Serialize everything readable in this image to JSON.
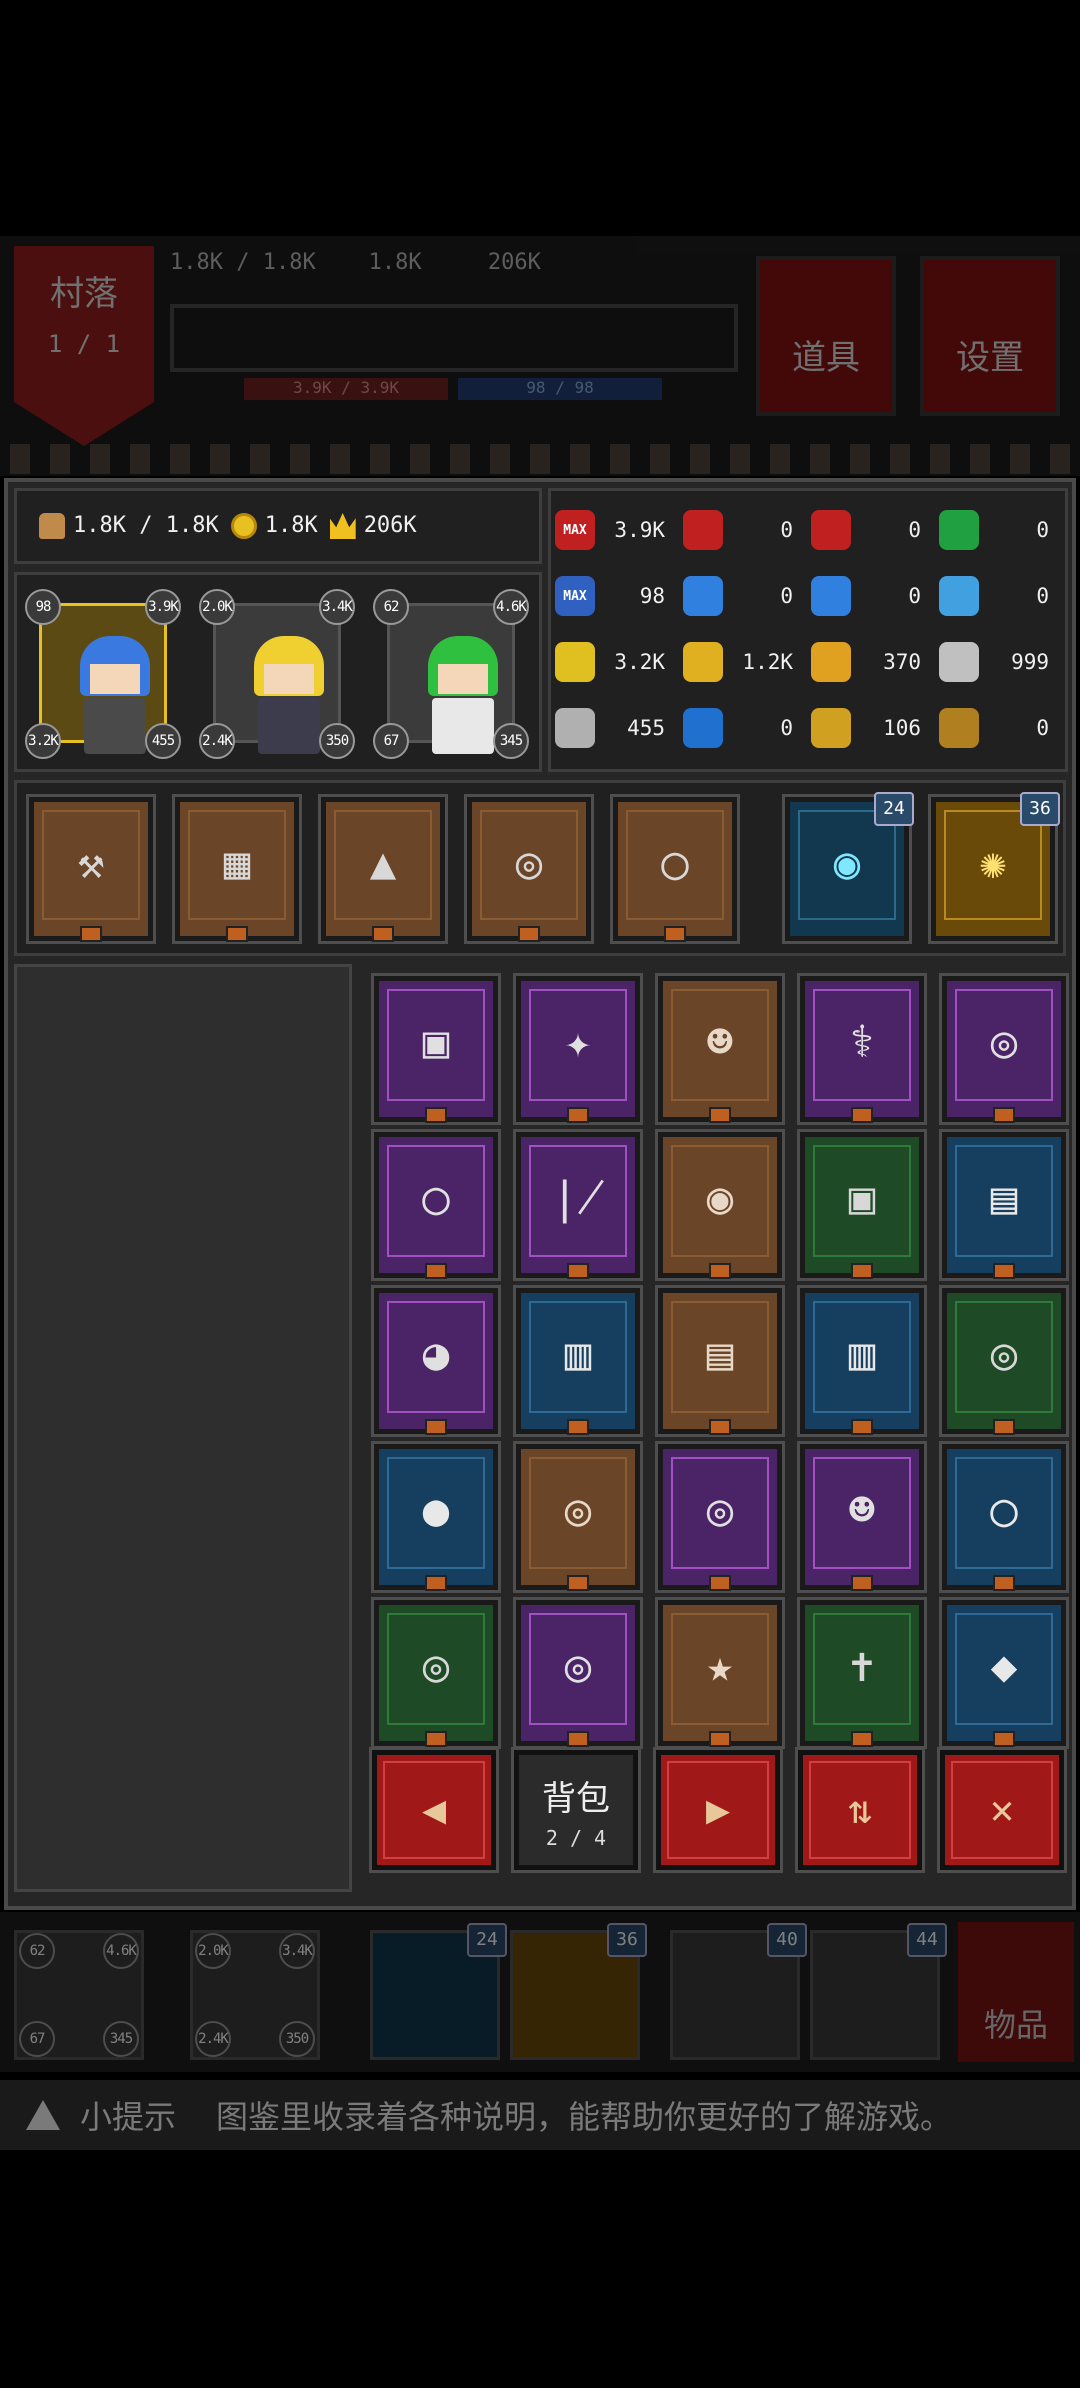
{
  "background_hud": {
    "village_label": "村落",
    "village_page": "1 / 1",
    "resources": "1.8K / 1.8K    1.8K     206K",
    "hp_bar": "3.9K / 3.9K",
    "mp_bar": "98 / 98",
    "items_button": "道具",
    "settings_button": "设置"
  },
  "resources": {
    "food": "1.8K / 1.8K",
    "gold": "1.8K",
    "crown": "206K"
  },
  "heroes": [
    {
      "top_left": "98",
      "top_right": "3.9K",
      "bottom_left": "3.2K",
      "bottom_right": "455",
      "hair": "#3a7ae0",
      "body": "#4a4a4a",
      "selected": true
    },
    {
      "top_left": "2.0K",
      "top_right": "3.4K",
      "bottom_left": "2.4K",
      "bottom_right": "350",
      "hair": "#f0d030",
      "body": "#3c3c4c",
      "selected": false
    },
    {
      "top_left": "62",
      "top_right": "4.6K",
      "bottom_left": "67",
      "bottom_right": "345",
      "hair": "#30c040",
      "body": "#e8e8e8",
      "selected": false
    }
  ],
  "stats": [
    {
      "icon": "max-heart-icon",
      "label": "MAX",
      "value": "3.9K",
      "color": "#c02020"
    },
    {
      "icon": "heart-plus-icon",
      "value": "0",
      "color": "#c02020"
    },
    {
      "icon": "heart-s-icon",
      "value": "0",
      "color": "#c02020"
    },
    {
      "icon": "green-heart-icon",
      "value": "0",
      "color": "#20a040"
    },
    {
      "icon": "max-mana-icon",
      "label": "MAX",
      "value": "98",
      "color": "#3060c0"
    },
    {
      "icon": "mana-potion-plus-icon",
      "value": "0",
      "color": "#3080e0"
    },
    {
      "icon": "mana-potion-s-icon",
      "value": "0",
      "color": "#3080e0"
    },
    {
      "icon": "blue-star-icon",
      "value": "0",
      "color": "#40a0e0"
    },
    {
      "icon": "gold-potion-icon",
      "value": "3.2K",
      "color": "#e0c020"
    },
    {
      "icon": "gold-coin-icon",
      "value": "1.2K",
      "color": "#e0b020"
    },
    {
      "icon": "gold-star-icon",
      "value": "370",
      "color": "#e0a020"
    },
    {
      "icon": "armor-shield-icon",
      "value": "999",
      "color": "#c0c0c0"
    },
    {
      "icon": "silver-shield-icon",
      "value": "455",
      "color": "#b0b0b0"
    },
    {
      "icon": "blue-gem-icon",
      "value": "0",
      "color": "#2070d0"
    },
    {
      "icon": "gold-badge-icon",
      "value": "106",
      "color": "#d0a020"
    },
    {
      "icon": "bronze-badge-icon",
      "value": "0",
      "color": "#b08020"
    }
  ],
  "equipment": [
    {
      "icon": "hammer-icon",
      "glyph": "⚒"
    },
    {
      "icon": "armor-plate-icon",
      "glyph": "▦"
    },
    {
      "icon": "hat-icon",
      "glyph": "▲"
    },
    {
      "icon": "necklace-icon",
      "glyph": "◎"
    },
    {
      "icon": "ring-icon",
      "glyph": "◯"
    }
  ],
  "skills": [
    {
      "icon": "signal-person-skill-icon",
      "count": "24"
    },
    {
      "icon": "golden-burst-skill-icon",
      "count": "36"
    }
  ],
  "bag_items": [
    {
      "icon": "gauntlet-icon",
      "glyph": "▣",
      "rarity": "purple"
    },
    {
      "icon": "shuriken-icon",
      "glyph": "✦",
      "rarity": "purple"
    },
    {
      "icon": "skull-ring-icon",
      "glyph": "☻",
      "rarity": "brown"
    },
    {
      "icon": "staff-icon",
      "glyph": "⚕",
      "rarity": "purple"
    },
    {
      "icon": "necklace-icon",
      "glyph": "◎",
      "rarity": "purple"
    },
    {
      "icon": "gold-ring-icon",
      "glyph": "◯",
      "rarity": "purple"
    },
    {
      "icon": "bone-wand-icon",
      "glyph": "∤",
      "rarity": "purple"
    },
    {
      "icon": "round-shield-icon",
      "glyph": "◉",
      "rarity": "brown"
    },
    {
      "icon": "gauntlet-icon",
      "glyph": "▣",
      "rarity": "green"
    },
    {
      "icon": "tunic-icon",
      "glyph": "▤",
      "rarity": "blue"
    },
    {
      "icon": "eye-amulet-icon",
      "glyph": "◕",
      "rarity": "purple"
    },
    {
      "icon": "spellbook-icon",
      "glyph": "▥",
      "rarity": "blue"
    },
    {
      "icon": "tunic-icon",
      "glyph": "▤",
      "rarity": "brown"
    },
    {
      "icon": "tome-icon",
      "glyph": "▥",
      "rarity": "blue"
    },
    {
      "icon": "necklace-icon",
      "glyph": "◎",
      "rarity": "green"
    },
    {
      "icon": "striped-orb-icon",
      "glyph": "●",
      "rarity": "blue"
    },
    {
      "icon": "necklace-icon",
      "glyph": "◎",
      "rarity": "brown"
    },
    {
      "icon": "bone-necklace-icon",
      "glyph": "◎",
      "rarity": "purple"
    },
    {
      "icon": "skull-ring-icon",
      "glyph": "☻",
      "rarity": "purple"
    },
    {
      "icon": "silver-ring-icon",
      "glyph": "◯",
      "rarity": "blue"
    },
    {
      "icon": "gem-necklace-icon",
      "glyph": "◎",
      "rarity": "green"
    },
    {
      "icon": "necklace-icon",
      "glyph": "◎",
      "rarity": "purple"
    },
    {
      "icon": "star-wand-icon",
      "glyph": "★",
      "rarity": "brown"
    },
    {
      "icon": "cross-ring-icon",
      "glyph": "✝",
      "rarity": "green"
    },
    {
      "icon": "crystal-icon",
      "glyph": "◆",
      "rarity": "blue"
    }
  ],
  "controls": {
    "prev": "◀",
    "bag_label": "背包",
    "bag_page": "2 / 4",
    "next": "▶",
    "sort": "⇅",
    "close": "✕"
  },
  "bottom_bar": {
    "counts": [
      "24",
      "36",
      "40",
      "44"
    ],
    "hero_a": {
      "top_left": "62",
      "top_right": "4.6K",
      "bottom_left": "67",
      "bottom_right": "345"
    },
    "hero_b": {
      "top_left": "2.0K",
      "top_right": "3.4K",
      "bottom_left": "2.4K",
      "bottom_right": "350"
    },
    "items_label": "物品"
  },
  "tip": {
    "label": "小提示",
    "text": "图鉴里收录着各种说明，能帮助你更好的了解游戏。"
  },
  "colors": {
    "purple": "#4a2466",
    "green": "#1f4a26",
    "blue": "#163e5e",
    "brown": "#6b4527",
    "gold_accent": "#e8c021",
    "red_button": "#a01818"
  }
}
